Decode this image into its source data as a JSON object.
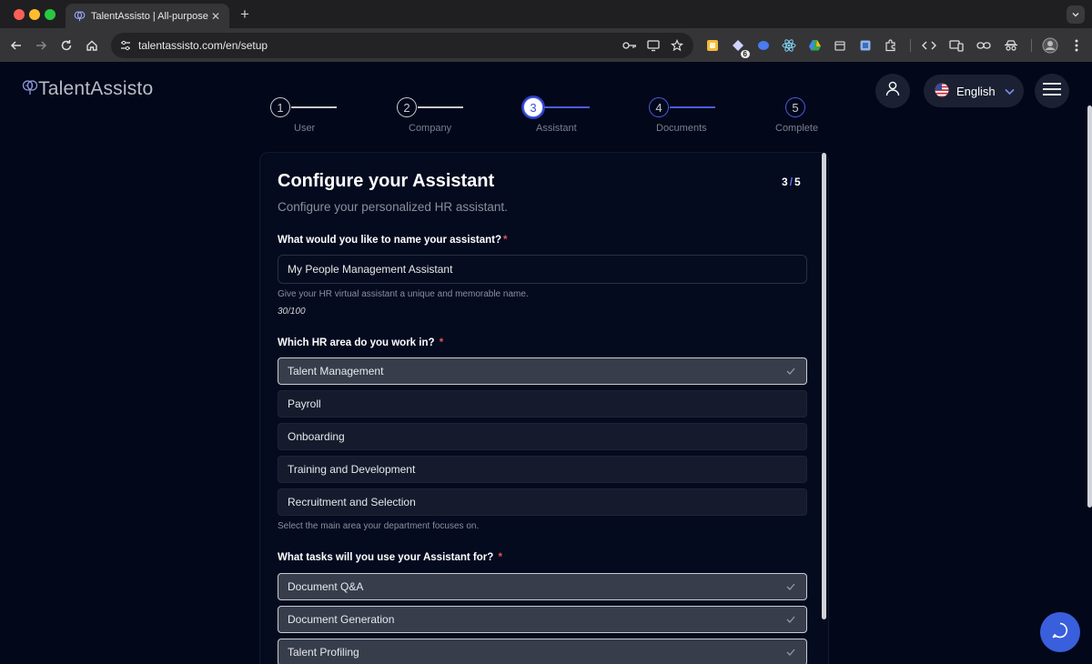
{
  "browser": {
    "tab_title": "TalentAssisto | All-purpose H",
    "url": "talentassisto.com/en/setup",
    "extension_badge": "6"
  },
  "header": {
    "logo_text": "TalentAssisto",
    "language": "English"
  },
  "steps": [
    {
      "number": "1",
      "label": "User"
    },
    {
      "number": "2",
      "label": "Company"
    },
    {
      "number": "3",
      "label": "Assistant"
    },
    {
      "number": "4",
      "label": "Documents"
    },
    {
      "number": "5",
      "label": "Complete"
    }
  ],
  "card": {
    "title": "Configure your Assistant",
    "subtitle": "Configure your personalized HR assistant.",
    "step_current": "3",
    "step_sep": "/",
    "step_total": "5"
  },
  "name_question": {
    "label": "What would you like to name your assistant?",
    "required": "*",
    "value": "My People Management Assistant",
    "help": "Give your HR virtual assistant a unique and memorable name.",
    "counter": "30/100"
  },
  "area_question": {
    "label": "Which HR area do you work in?",
    "required": "*",
    "options": [
      "Talent Management",
      "Payroll",
      "Onboarding",
      "Training and Development",
      "Recruitment and Selection"
    ],
    "help": "Select the main area your department focuses on."
  },
  "tasks_question": {
    "label": "What tasks will you use your Assistant for?",
    "required": "*",
    "options": [
      "Document Q&A",
      "Document Generation",
      "Talent Profiling"
    ]
  },
  "colors": {
    "page_bg": "#02071a",
    "accent": "#5b6ef0",
    "chat_button": "#3a5fdc",
    "required": "#e05555"
  }
}
